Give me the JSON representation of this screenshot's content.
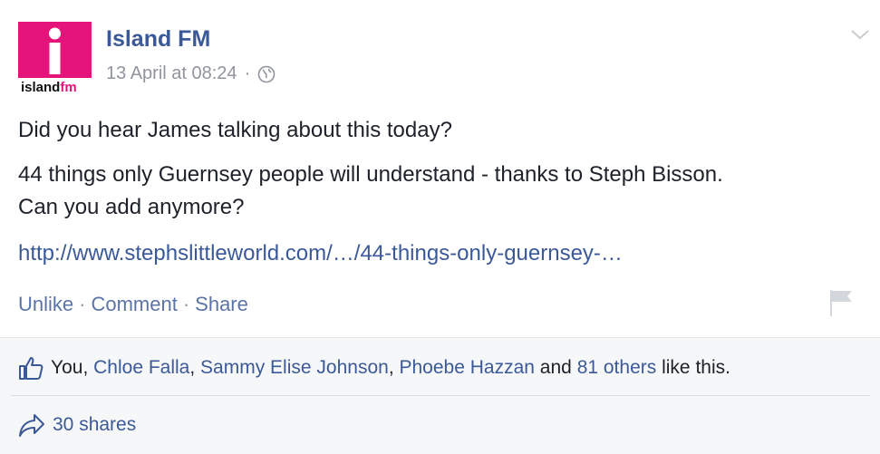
{
  "post": {
    "page_name": "Island FM",
    "logo_text": "islandfm",
    "timestamp": "13 April at 08:24",
    "meta_separator": "·",
    "icons": {
      "audience": "globe-icon",
      "menu": "chevron-down-icon",
      "flag": "flag-icon"
    },
    "message_line1": "Did you hear James talking about this today?",
    "message_line2": "44 things only Guernsey people will understand - thanks to Steph Bisson.",
    "message_line3": "Can you add anymore?",
    "link": "http://www.stephslittleworld.com/…/44-things-only-guernsey-…",
    "actions": {
      "unlike": "Unlike",
      "comment": "Comment",
      "share": "Share",
      "separator": "·"
    }
  },
  "likes": {
    "icon": "thumbs-up-icon",
    "you": "You,",
    "name1": "Chloe Falla",
    "comma1": ",",
    "name2": "Sammy Elise Johnson",
    "comma2": ",",
    "name3": "Phoebe Hazzan",
    "and": "and",
    "others": "81 others",
    "suffix": "like this."
  },
  "shares": {
    "icon": "share-arrow-icon",
    "label": "30 shares"
  },
  "colors": {
    "brand_blue": "#3b5998",
    "logo_pink": "#e4147a",
    "muted_gray": "#90949c",
    "text": "#1d2129"
  }
}
